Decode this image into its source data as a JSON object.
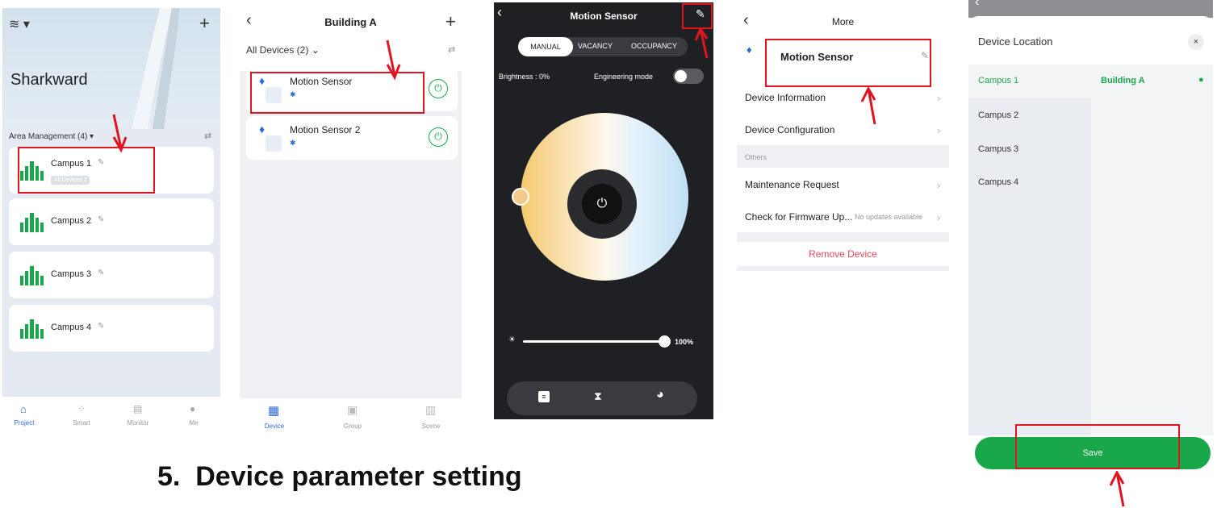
{
  "panel1": {
    "project_name": "Sharkward",
    "area_header": "Area Management (4)",
    "campuses": [
      {
        "name": "Campus 1",
        "sub": "All Devices 2"
      },
      {
        "name": "Campus 2"
      },
      {
        "name": "Campus 3"
      },
      {
        "name": "Campus 4"
      }
    ],
    "tabs": [
      "Project",
      "Smart",
      "Monitor",
      "Me"
    ]
  },
  "panel2": {
    "title": "Building A",
    "filter_label": "All Devices (2)",
    "devices": [
      {
        "name": "Motion Sensor"
      },
      {
        "name": "Motion Sensor 2"
      }
    ],
    "tabs": [
      "Device",
      "Group",
      "Scene"
    ]
  },
  "panel3": {
    "title": "Motion Sensor",
    "modes": [
      "MANUAL",
      "VACANCY",
      "OCCUPANCY"
    ],
    "brightness_label": "Brightness : 0%",
    "engineering_label": "Engineering mode",
    "slider_value": "100%"
  },
  "panel4": {
    "title": "More",
    "device_name": "Motion Sensor",
    "items": [
      "Device Information",
      "Device Configuration"
    ],
    "section_label": "Others",
    "others": [
      "Maintenance Request",
      "Check for Firmware Up..."
    ],
    "firmware_status": "No updates available",
    "remove_label": "Remove Device"
  },
  "panel5": {
    "title": "Device Location",
    "campuses": [
      "Campus 1",
      "Campus 2",
      "Campus 3",
      "Campus 4"
    ],
    "building": "Building A",
    "save_label": "Save"
  },
  "caption": "5.  Device parameter setting",
  "colors": {
    "accent_green": "#18a84a",
    "red_annotation": "#e0141e",
    "remove_red": "#e8485a"
  }
}
